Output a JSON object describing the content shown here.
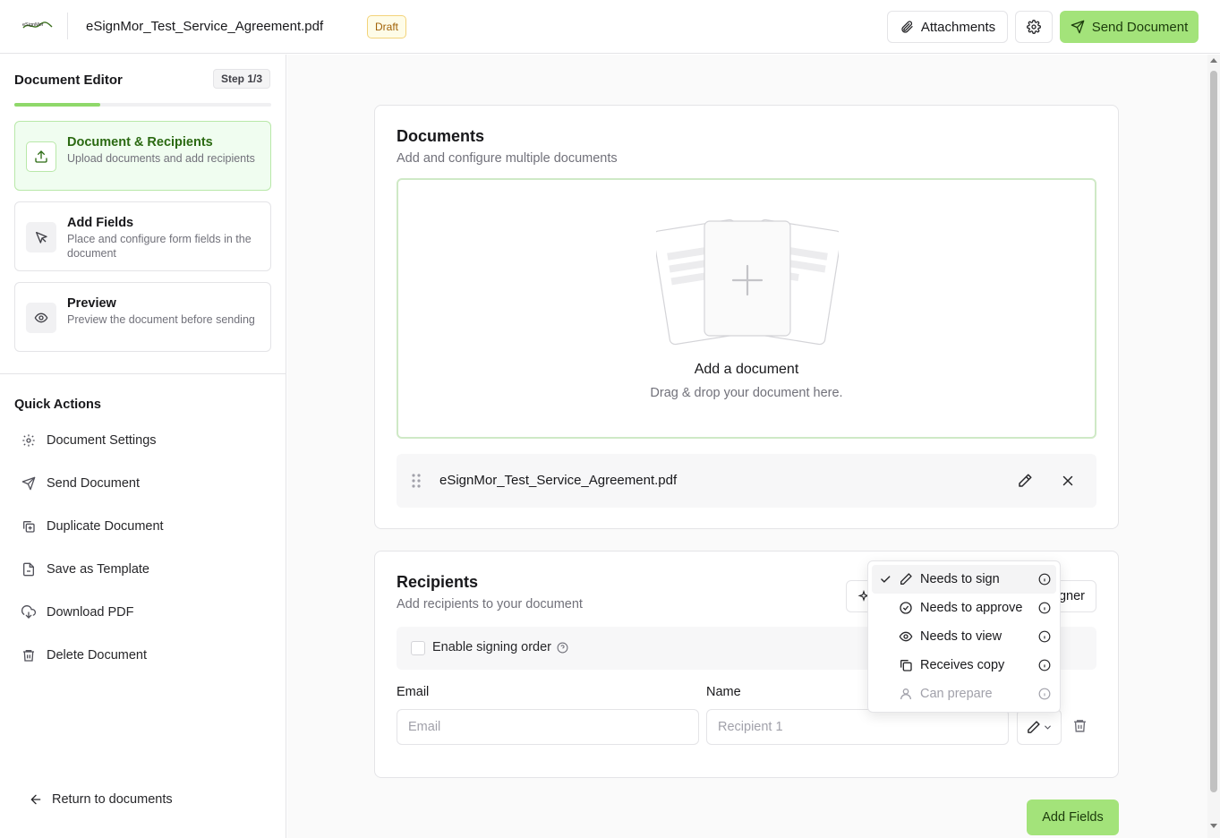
{
  "header": {
    "logo_text": "eSignMor",
    "doc_title": "eSignMor_Test_Service_Agreement.pdf",
    "status_badge": "Draft",
    "attachments_label": "Attachments",
    "send_label": "Send Document"
  },
  "sidebar": {
    "title": "Document Editor",
    "step_badge": "Step 1/3",
    "progress": 0.333,
    "steps": [
      {
        "name": "Document & Recipients",
        "desc": "Upload documents and add recipients",
        "icon": "upload-icon",
        "active": true
      },
      {
        "name": "Add Fields",
        "desc": "Place and configure form fields in the document",
        "icon": "cursor-icon",
        "active": false
      },
      {
        "name": "Preview",
        "desc": "Preview the document before sending",
        "icon": "eye-icon",
        "active": false
      }
    ],
    "quick_actions_title": "Quick Actions",
    "quick_actions": [
      {
        "label": "Document Settings",
        "icon": "gear-icon"
      },
      {
        "label": "Send Document",
        "icon": "send-icon"
      },
      {
        "label": "Duplicate Document",
        "icon": "duplicate-icon"
      },
      {
        "label": "Save as Template",
        "icon": "template-icon"
      },
      {
        "label": "Download PDF",
        "icon": "download-cloud-icon"
      },
      {
        "label": "Delete Document",
        "icon": "trash-icon"
      }
    ],
    "return_label": "Return to documents"
  },
  "documents": {
    "title": "Documents",
    "subtitle": "Add and configure multiple documents",
    "dropzone_title": "Add a document",
    "dropzone_sub": "Drag & drop your document here.",
    "files": [
      {
        "name": "eSignMor_Test_Service_Agreement.pdf"
      }
    ]
  },
  "recipients": {
    "title": "Recipients",
    "subtitle": "Add recipients to your document",
    "add_signer_label": "gner",
    "signing_order_label": "Enable signing order",
    "email_label": "Email",
    "name_label": "Name",
    "email_placeholder": "Email",
    "name_placeholder": "Recipient 1"
  },
  "role_menu": [
    {
      "label": "Needs to sign",
      "icon": "pen-icon",
      "selected": true,
      "disabled": false
    },
    {
      "label": "Needs to approve",
      "icon": "check-circle-icon",
      "selected": false,
      "disabled": false
    },
    {
      "label": "Needs to view",
      "icon": "eye-icon",
      "selected": false,
      "disabled": false
    },
    {
      "label": "Receives copy",
      "icon": "copy-icon",
      "selected": false,
      "disabled": false
    },
    {
      "label": "Can prepare",
      "icon": "user-icon",
      "selected": false,
      "disabled": true
    }
  ],
  "footer": {
    "add_fields_label": "Add Fields"
  },
  "colors": {
    "accent": "#a3e37a",
    "accent_text": "#1c3b0c",
    "active_step_bg": "#f0fdf0",
    "draft_badge": "#a16207"
  }
}
